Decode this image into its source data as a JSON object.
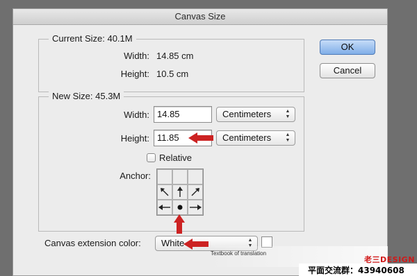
{
  "dialog": {
    "title": "Canvas Size"
  },
  "current_size": {
    "title": "Current Size: 40.1M",
    "width_label": "Width:",
    "width_value": "14.85 cm",
    "height_label": "Height:",
    "height_value": "10.5 cm"
  },
  "new_size": {
    "title": "New Size: 45.3M",
    "width_label": "Width:",
    "width_value": "14.85",
    "width_unit": "Centimeters",
    "height_label": "Height:",
    "height_value": "11.85",
    "height_unit": "Centimeters",
    "relative_label": "Relative",
    "relative_checked": false,
    "anchor_label": "Anchor:"
  },
  "extension": {
    "label": "Canvas extension color:",
    "value": "White",
    "swatch_color": "#ffffff"
  },
  "buttons": {
    "ok": "OK",
    "cancel": "Cancel"
  },
  "watermark": {
    "caption": "Textbook of translation",
    "brand": "老三DESIGN",
    "group": "平面交流群：43940608"
  },
  "colors": {
    "highlight_arrow": "#cc2222",
    "primary_button": "#80aee8"
  }
}
